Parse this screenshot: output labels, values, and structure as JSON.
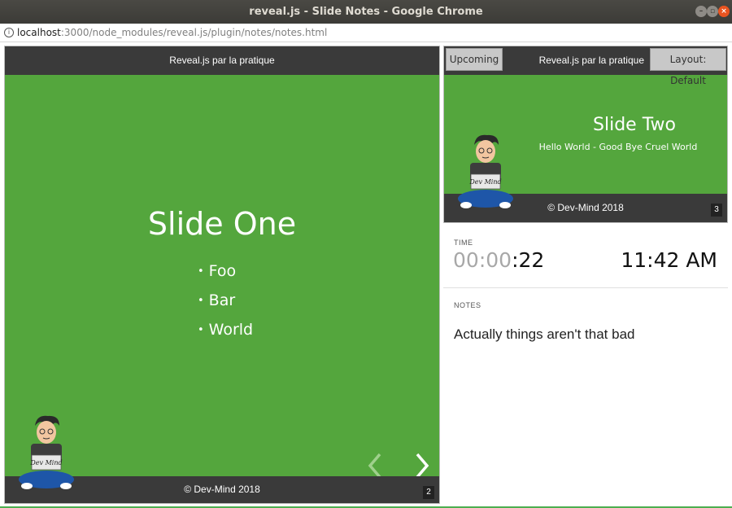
{
  "window": {
    "title": "reveal.js - Slide Notes - Google Chrome"
  },
  "address_bar": {
    "url_host": "localhost",
    "url_rest": ":3000/node_modules/reveal.js/plugin/notes/notes.html"
  },
  "current_slide": {
    "header": "Reveal.js par la pratique",
    "title": "Slide One",
    "bullets": [
      "Foo",
      "Bar",
      "World"
    ],
    "bullet_glyph": "•",
    "footer": "© Dev-Mind 2018",
    "slide_number": "2",
    "mascot_text": "Dev Mind"
  },
  "upcoming_slide": {
    "upcoming_button": "Upcoming",
    "header": "Reveal.js par la pratique",
    "layout_button": "Layout: Default",
    "title": "Slide Two",
    "subtitle": "Hello World - Good Bye Cruel World",
    "footer": "© Dev-Mind 2018",
    "slide_number": "3",
    "mascot_text": "Dev Mind"
  },
  "timer": {
    "label": "TIME",
    "hours": "00",
    "minutes": "00",
    "seconds": "22",
    "separator": ":",
    "clock": "11:42 AM"
  },
  "notes": {
    "label": "NOTES",
    "text": "Actually things aren't that bad"
  },
  "colors": {
    "slide_background": "#54a63d",
    "bar_background": "#3a3a3a",
    "close_button": "#e95420"
  },
  "icons": {
    "info": "info-icon",
    "prev_arrow": "chevron-left-icon",
    "next_arrow": "chevron-right-icon"
  }
}
